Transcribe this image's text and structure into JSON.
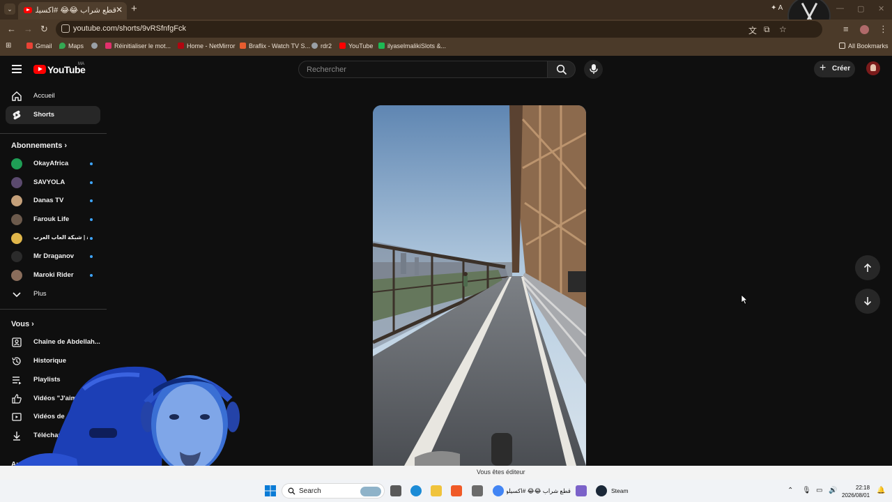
{
  "browser": {
    "tab_title": "قطع شراب 😂😂 #اكسيلور",
    "url": "youtube.com/shorts/9vRSfnfgFck",
    "ai_chip": "A",
    "bookmarks": [
      {
        "label": "Gmail",
        "color": "#ea4335"
      },
      {
        "label": "Maps",
        "color": "#34a853"
      },
      {
        "label": "",
        "color": "#9aa0a6"
      },
      {
        "label": "Réinitialiser le mot...",
        "color": "#e1306c"
      },
      {
        "label": "Home - NetMirror",
        "color": "#b00610"
      },
      {
        "label": "Braflix - Watch TV S...",
        "color": "#e85d2f"
      },
      {
        "label": "rdr2",
        "color": "#9aa0a6"
      },
      {
        "label": "YouTube",
        "color": "#ff0000"
      },
      {
        "label": "ilyaselmalikiSlots &...",
        "color": "#1db954"
      }
    ],
    "all_bookmarks": "All Bookmarks"
  },
  "youtube": {
    "logo_text": "YouTube",
    "logo_region": "MA",
    "search_placeholder": "Rechercher",
    "create_label": "Créer",
    "sidebar": {
      "main": [
        {
          "label": "Accueil",
          "icon": "home-icon"
        },
        {
          "label": "Shorts",
          "icon": "shorts-icon"
        }
      ],
      "subscriptions_heading": "Abonnements",
      "subscriptions": [
        {
          "label": "OkayAfrica",
          "color": "#1f9d55"
        },
        {
          "label": "SAVYOLA",
          "color": "#5b4a6e"
        },
        {
          "label": "Danas TV",
          "color": "#c4a07a"
        },
        {
          "label": "Farouk Life",
          "color": "#6c5a4c"
        },
        {
          "label": "شبكة العاب العرب | Ar...",
          "color": "#e0b64a"
        },
        {
          "label": "Mr Draganov",
          "color": "#2b2b2b"
        },
        {
          "label": "Maroki Rider",
          "color": "#8a6d5b"
        }
      ],
      "more_label": "Plus",
      "you_heading": "Vous",
      "you_items": [
        {
          "label": "Chaîne de Abdellah...",
          "icon": "channel-icon"
        },
        {
          "label": "Historique",
          "icon": "history-icon"
        },
        {
          "label": "Playlists",
          "icon": "playlists-icon"
        },
        {
          "label": "Vidéos \"J'aime\"",
          "icon": "like-icon"
        },
        {
          "label": "Vidéos de Ab",
          "icon": "your-videos-icon"
        },
        {
          "label": "Téléchar",
          "icon": "download-icon"
        }
      ],
      "other_heading": "Autr"
    }
  },
  "notification": {
    "text": "Vous êtes éditeur"
  },
  "taskbar": {
    "search_placeholder": "Search",
    "window_label": "قطع شراب 😂😂 #اكسيلور",
    "steam_label": "Steam",
    "time": "22:18",
    "date": "2026/08/01"
  }
}
